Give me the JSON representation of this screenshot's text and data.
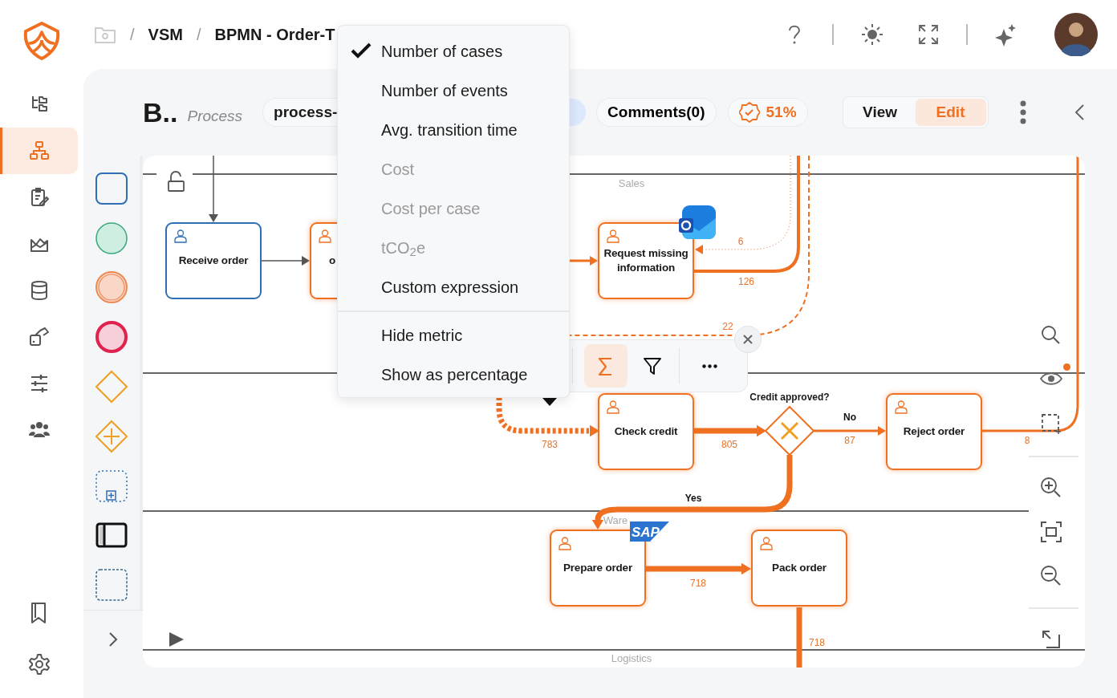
{
  "sidebar": {
    "items": [
      {
        "kind": "tree",
        "selected": false
      },
      {
        "kind": "hierarchy",
        "selected": true
      },
      {
        "kind": "clipboard",
        "selected": false
      },
      {
        "kind": "chart",
        "selected": false
      },
      {
        "kind": "database",
        "selected": false
      },
      {
        "kind": "cube",
        "selected": false
      },
      {
        "kind": "sliders",
        "selected": false
      },
      {
        "kind": "people",
        "selected": false
      }
    ]
  },
  "breadcrumb": [
    {
      "separator": "/",
      "label": "VSM"
    },
    {
      "separator": "/",
      "label": "BPMN - Order-T"
    }
  ],
  "header": {
    "title": "B..",
    "subtitle": "Process",
    "process_tag": "process-",
    "comments": "Comments(0)",
    "score": "51%",
    "modes": [
      {
        "label": "View",
        "selected": false
      },
      {
        "label": "Edit",
        "selected": true
      }
    ]
  },
  "lanes": [
    "Sales",
    "Ware",
    "Logistics"
  ],
  "tasks": [
    {
      "label": "Receive order",
      "highlighted": false
    },
    {
      "label": "o",
      "highlighted": true
    },
    {
      "label": "Request missing information",
      "highlighted": true
    },
    {
      "label": "Check credit",
      "highlighted": true
    },
    {
      "label": "Reject order",
      "highlighted": true
    },
    {
      "label": "Prepare order",
      "highlighted": true
    },
    {
      "label": "Pack order",
      "highlighted": true
    }
  ],
  "gateway": {
    "label": "Credit approved?"
  },
  "sap_logo": "SAP",
  "edge_labels": [
    {
      "text": "6",
      "kind": "count"
    },
    {
      "text": "126",
      "kind": "count"
    },
    {
      "text": "22",
      "kind": "count"
    },
    {
      "text": "783",
      "kind": "count"
    },
    {
      "text": "805",
      "kind": "count"
    },
    {
      "text": "No",
      "kind": "condition"
    },
    {
      "text": "87",
      "kind": "count"
    },
    {
      "text": "8",
      "kind": "count"
    },
    {
      "text": "Yes",
      "kind": "condition"
    },
    {
      "text": "718",
      "kind": "count"
    },
    {
      "text": "718",
      "kind": "count"
    }
  ],
  "metric_toolbar": {
    "buttons": [
      {
        "kind": "sum",
        "selected": true
      },
      {
        "kind": "filter",
        "selected": false
      },
      {
        "kind": "more",
        "selected": false
      }
    ]
  },
  "metric_menu": {
    "metrics": [
      {
        "label": "Number of cases",
        "checked": true,
        "disabled": false
      },
      {
        "label": "Number of events",
        "checked": false,
        "disabled": false
      },
      {
        "label": "Avg. transition time",
        "checked": false,
        "disabled": false
      },
      {
        "label": "Cost",
        "checked": false,
        "disabled": true
      },
      {
        "label": "Cost per case",
        "checked": false,
        "disabled": true
      },
      {
        "label": "tCO$_{2}$e",
        "checked": false,
        "disabled": true
      },
      {
        "label": "Custom expression",
        "checked": false,
        "disabled": false
      }
    ],
    "options": [
      "Hide metric",
      "Show as percentage"
    ]
  }
}
